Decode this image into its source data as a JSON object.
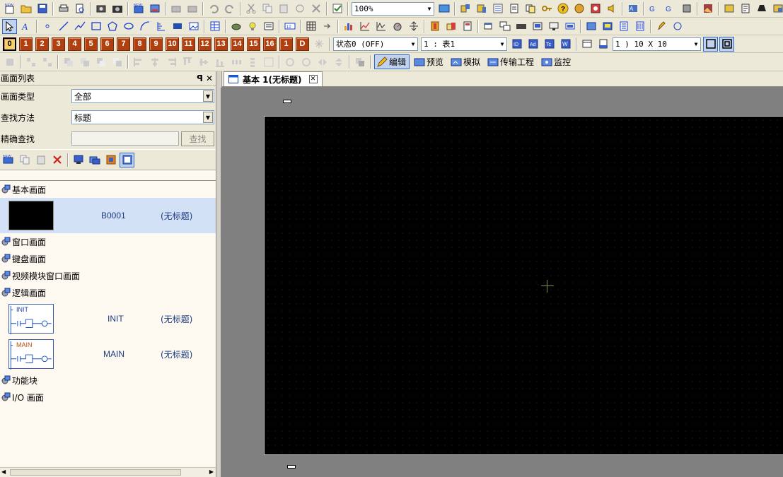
{
  "toolbar": {
    "zoom": "100%",
    "state_combo": "状态0 (OFF)",
    "sheet_combo": "1 : 表1",
    "grid_combo": "1 ) 10 X 10",
    "screen_numbers": [
      "0",
      "1",
      "2",
      "3",
      "4",
      "5",
      "6",
      "7",
      "8",
      "9",
      "10",
      "11",
      "12",
      "13",
      "14",
      "15",
      "16",
      "1",
      "D"
    ],
    "modes": [
      {
        "label": "编辑",
        "active": true
      },
      {
        "label": "预览",
        "active": false
      },
      {
        "label": "模拟",
        "active": false
      },
      {
        "label": "传输工程",
        "active": false
      },
      {
        "label": "监控",
        "active": false
      }
    ]
  },
  "screen_list": {
    "title": "画面列表",
    "pin_glyph": "ꟼ",
    "close_glyph": "✕",
    "type_label": "画面类型",
    "type_value": "全部",
    "method_label": "查找方法",
    "method_value": "标题",
    "exact_label": "精确查找",
    "search_button": "查找",
    "categories": {
      "basic": "基本画面",
      "window": "窗口画面",
      "keyboard": "键盘画面",
      "video": "视频模块窗口画面",
      "logic": "逻辑画面",
      "function": "功能块",
      "io": "I/O 画面"
    },
    "basic_items": [
      {
        "id": "B0001",
        "title": "(无标题)"
      }
    ],
    "logic_items": [
      {
        "id": "INIT",
        "title": "(无标题)",
        "thumb_label": "INIT"
      },
      {
        "id": "MAIN",
        "title": "(无标题)",
        "thumb_label": "MAIN"
      }
    ]
  },
  "editor": {
    "tab_label": "基本 1(无标题)",
    "tab_close": "✕"
  }
}
